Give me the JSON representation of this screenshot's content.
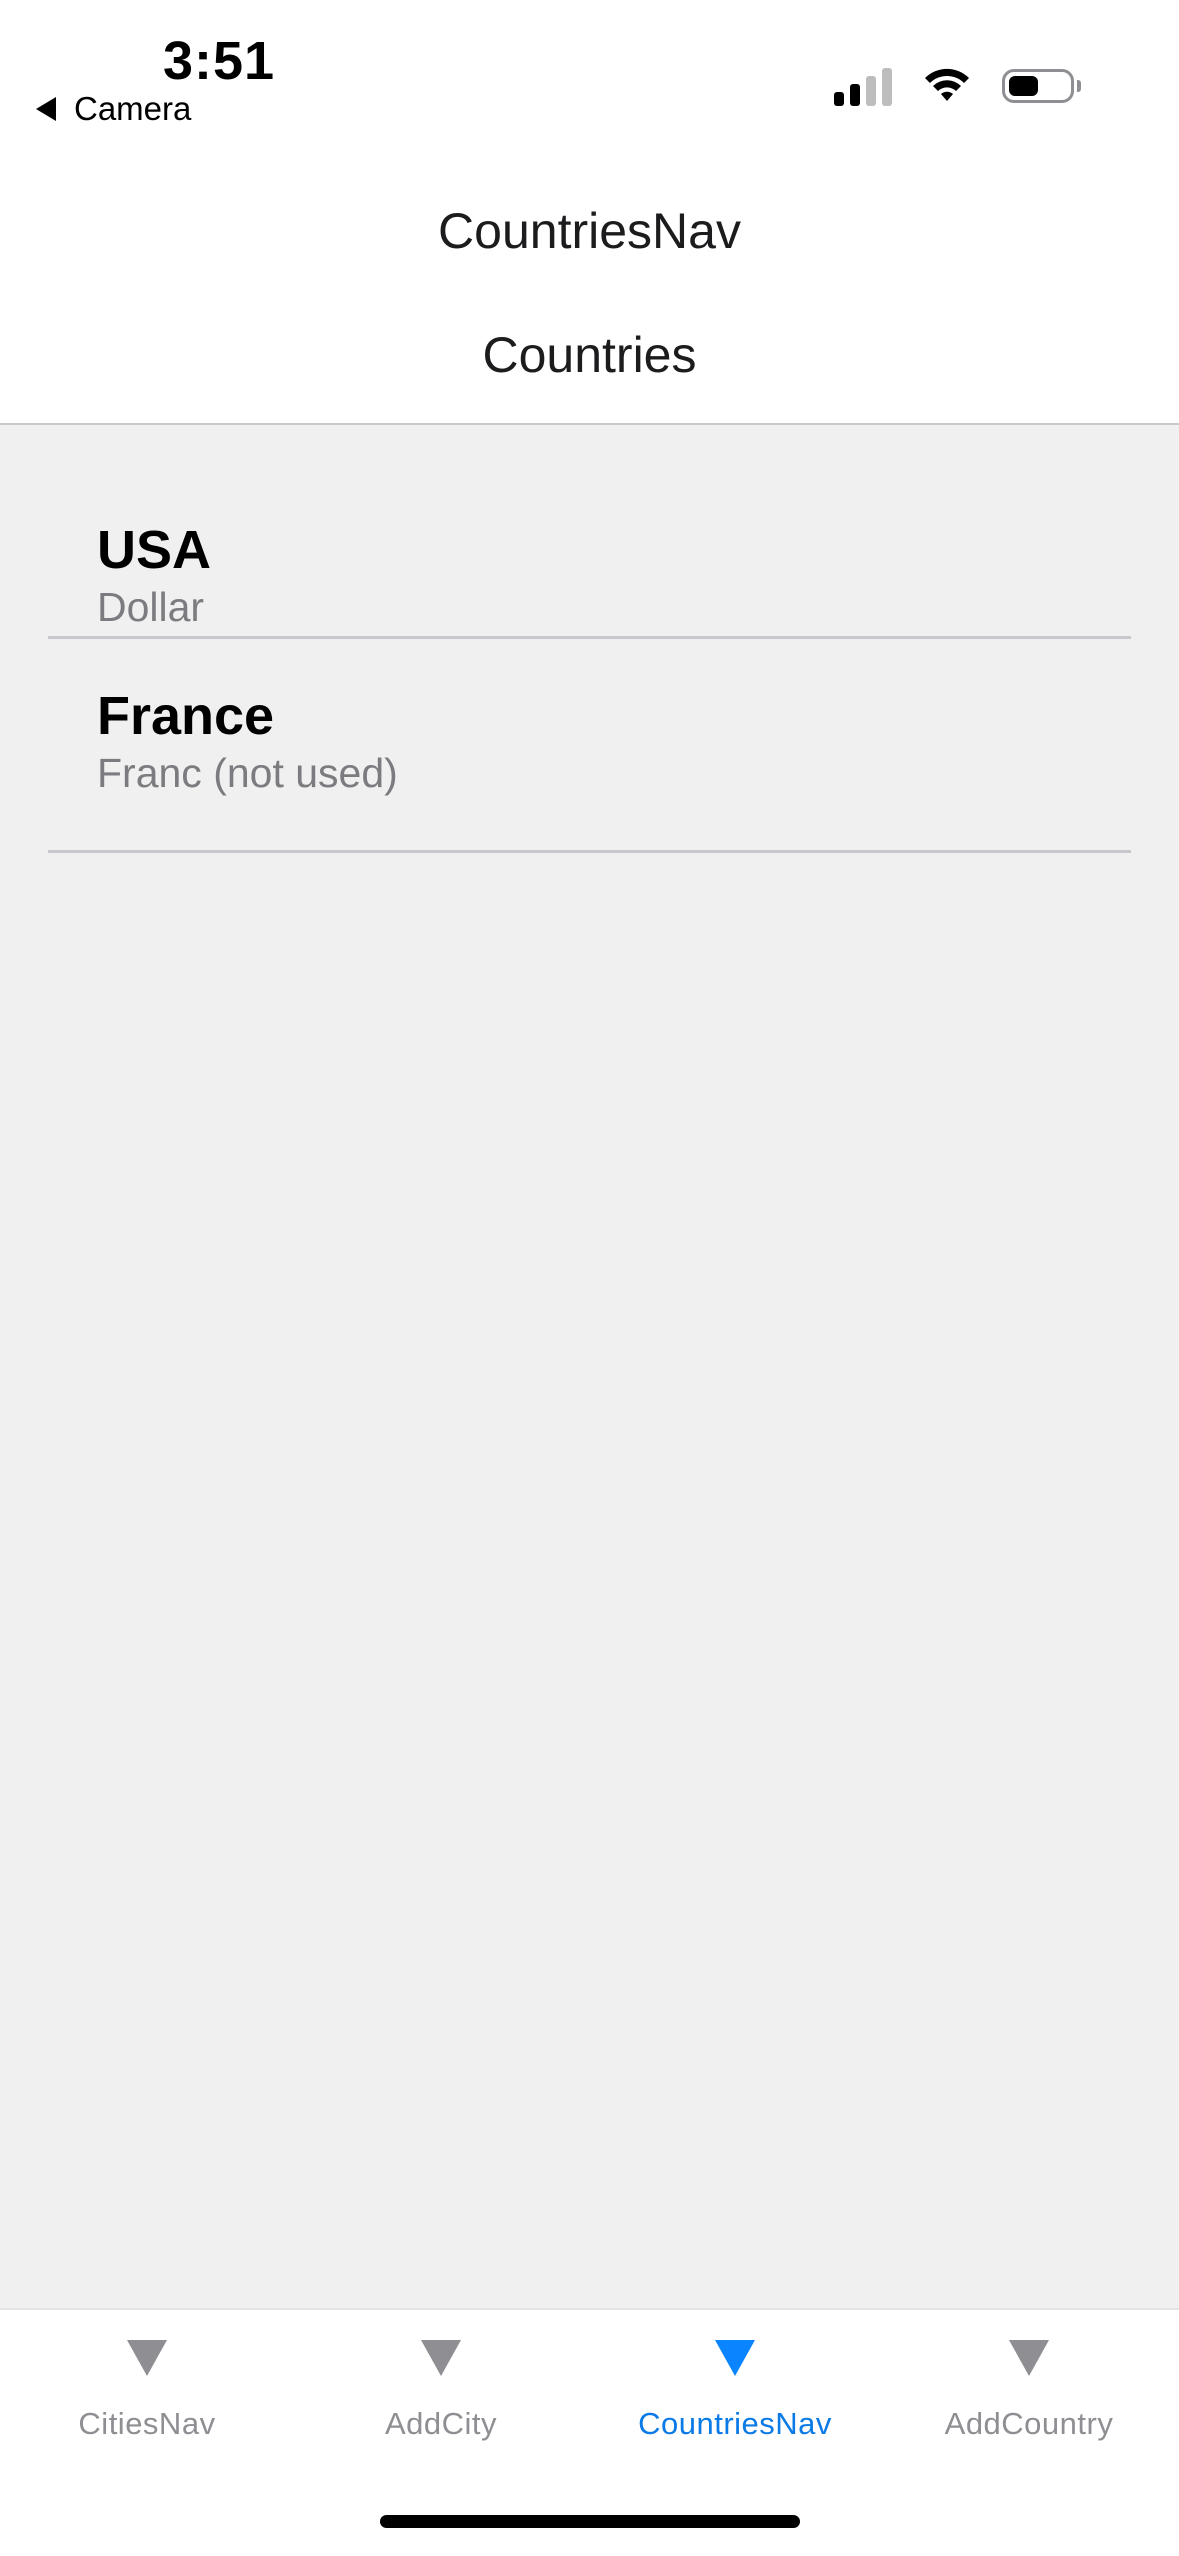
{
  "status_bar": {
    "time": "3:51",
    "back_app_label": "Camera",
    "signal_icon": "cellular-signal-icon",
    "wifi_icon": "wifi-icon",
    "battery_icon": "battery-icon",
    "battery_level": 0.5
  },
  "nav": {
    "title": "CountriesNav",
    "page_title": "Countries"
  },
  "countries": [
    {
      "name": "USA",
      "currency": "Dollar"
    },
    {
      "name": "France",
      "currency": "Franc (not used)"
    }
  ],
  "tab_bar": {
    "tabs": [
      {
        "label": "CitiesNav",
        "icon": "triangle-down-icon",
        "active": false
      },
      {
        "label": "AddCity",
        "icon": "triangle-down-icon",
        "active": false
      },
      {
        "label": "CountriesNav",
        "icon": "triangle-down-icon",
        "active": true
      },
      {
        "label": "AddCountry",
        "icon": "triangle-down-icon",
        "active": false
      }
    ]
  },
  "colors": {
    "accent": "#0a84ff",
    "inactive": "#8e8e93",
    "content_background": "#f0f0f0"
  }
}
